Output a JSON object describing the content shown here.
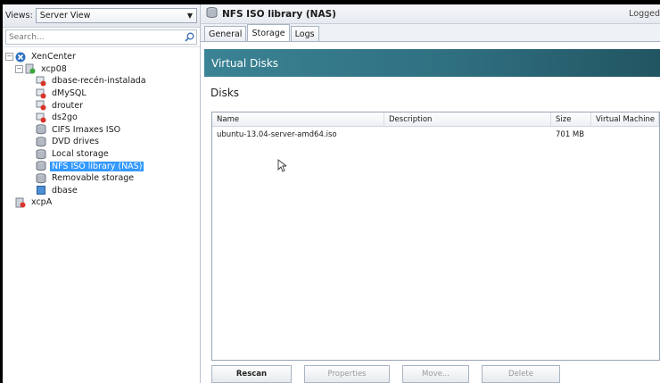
{
  "left_pane": {
    "views_label": "Views:",
    "view_select": "Server View",
    "search_placeholder": "Search...",
    "tree": [
      {
        "label": "XenCenter",
        "icon": "xencenter-icon",
        "expander": "−",
        "level": 0
      },
      {
        "label": "xcp08",
        "icon": "server-icon",
        "expander": "−",
        "level": 1
      },
      {
        "label": "dbase-recén-instalada",
        "icon": "vm-stopped-icon",
        "level": 2
      },
      {
        "label": "dMySQL",
        "icon": "vm-stopped-icon",
        "level": 2
      },
      {
        "label": "drouter",
        "icon": "vm-stopped-icon",
        "level": 2
      },
      {
        "label": "ds2go",
        "icon": "vm-stopped-icon",
        "level": 2
      },
      {
        "label": "CIFS Imaxes ISO",
        "icon": "storage-icon",
        "level": 2
      },
      {
        "label": "DVD drives",
        "icon": "storage-icon",
        "level": 2
      },
      {
        "label": "Local storage",
        "icon": "storage-icon",
        "level": 2
      },
      {
        "label": "NFS ISO library (NAS)",
        "icon": "storage-icon",
        "level": 2,
        "selected": true
      },
      {
        "label": "Removable storage",
        "icon": "storage-icon",
        "level": 2
      },
      {
        "label": "dbase",
        "icon": "template-icon",
        "level": 2
      },
      {
        "label": "xcpA",
        "icon": "server-disconnected-icon",
        "level": 1
      }
    ]
  },
  "right_pane": {
    "title": "NFS ISO library (NAS)",
    "logged": "Logged",
    "tabs": [
      "General",
      "Storage",
      "Logs"
    ],
    "active_tab": "Storage",
    "banner": "Virtual Disks",
    "section": "Disks",
    "columns": [
      "Name",
      "Description",
      "Size",
      "Virtual Machine"
    ],
    "rows": [
      {
        "name": "ubuntu-13.04-server-amd64.iso",
        "description": "",
        "size": "701 MB",
        "vm": ""
      }
    ],
    "buttons": {
      "rescan": "Rescan",
      "properties": "Properties",
      "move": "Move...",
      "delete": "Delete"
    }
  },
  "colors": {
    "banner": "#2f6f80",
    "selection": "#3399ff"
  }
}
